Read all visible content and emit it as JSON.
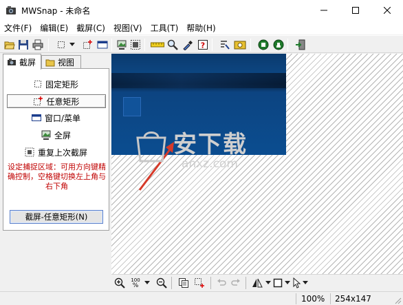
{
  "window": {
    "title": "MWSnap - 未命名",
    "minimize_glyph": "—",
    "maximize_glyph": "☐",
    "close_glyph": "✕"
  },
  "menu": {
    "items": [
      "文件(F)",
      "编辑(E)",
      "截屏(C)",
      "视图(V)",
      "工具(T)",
      "帮助(H)"
    ]
  },
  "toolbar": {
    "icons": [
      "open-icon",
      "save-icon",
      "print-icon",
      "fixed-rect-icon",
      "dropdown-icon",
      "any-rect-icon",
      "window-menu-icon",
      "fullscreen-icon",
      "repeat-capture-icon",
      "ruler-icon",
      "magnifier-icon",
      "color-picker-icon",
      "help-icon",
      "settings-icon",
      "hotkey-icon",
      "record-icon",
      "stop-icon",
      "exit-icon"
    ]
  },
  "tabs": {
    "capture": "截屏",
    "view": "视图"
  },
  "capture_panel": {
    "options": [
      "固定矩形",
      "任意矩形",
      "窗口/菜单",
      "全屏",
      "重复上次截屏"
    ],
    "selected_index": 1,
    "hint": "设定捕捉区域：可用方向键精确控制，空格键切换左上角与右下角",
    "capture_button": "截屏-任意矩形(N)"
  },
  "canvas": {
    "watermark_text": "安下载",
    "watermark_url": "anxz.com"
  },
  "bottom_toolbar": {
    "zoom_percent_label": "100",
    "zoom_percent_sign": "%"
  },
  "status": {
    "zoom": "100%",
    "size": "254x147"
  },
  "colors": {
    "hint_red": "#c00000",
    "screenshot_blue": "#0b4d90",
    "annotation_arrow": "#d63a2a"
  }
}
